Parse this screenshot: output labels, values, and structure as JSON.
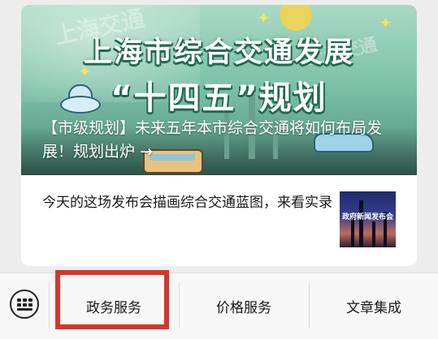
{
  "banner": {
    "title_line1": "上海市综合交通发展",
    "title_line2": "“十四五”规划",
    "watermark": "上海交通",
    "headline": "【市级规划】未来五年本市综合交通将如何布局发展！规划出炉 →"
  },
  "second_article": {
    "text": "今天的这场发布会描画综合交通蓝图，来看实录",
    "thumbnail_caption": "政府新闻发布会"
  },
  "bottom_menu": {
    "keyboard_icon": "keyboard-icon",
    "items": [
      {
        "label": "政务服务"
      },
      {
        "label": "价格服务"
      },
      {
        "label": "文章集成"
      }
    ],
    "highlight_color": "#d8352a"
  }
}
